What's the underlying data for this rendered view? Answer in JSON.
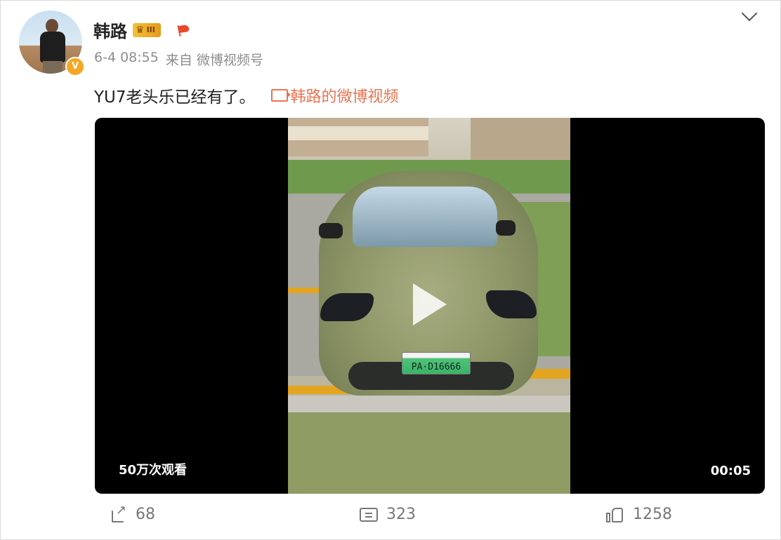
{
  "post": {
    "username": "韩路",
    "level_badge": "III",
    "time": "6-4 08:55",
    "source_prefix": "来自",
    "source": "微博视频号",
    "text": "YU7老头乐已经有了。",
    "video_link_label": "韩路的微博视频"
  },
  "video": {
    "views": "50万次观看",
    "duration": "00:05",
    "plate": "PA·D16666"
  },
  "actions": {
    "repost_count": "68",
    "comment_count": "323",
    "like_count": "1258"
  },
  "icons": [
    "avatar",
    "verified-icon",
    "crown-icon",
    "flag-icon",
    "chevron-down-icon",
    "video-icon",
    "play-icon",
    "repost-icon",
    "comment-icon",
    "like-icon"
  ],
  "colors": {
    "accent": "#eb7350",
    "badge": "#f3c13a",
    "verified": "#f5a623"
  }
}
